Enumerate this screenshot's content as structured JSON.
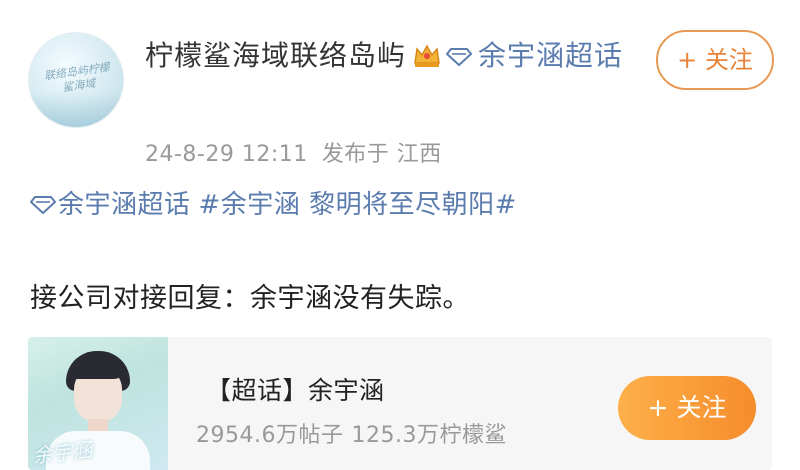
{
  "post": {
    "avatar_text": "联络岛屿柠檬鲨海域",
    "author": {
      "name": "柠檬鲨海域联络岛屿",
      "badge_icon": "crown-icon",
      "topic_link": "余宇涵超话"
    },
    "timestamp": "24-8-29 12:11",
    "location_label": "发布于 江西",
    "follow_label": "+ 关注",
    "topics": {
      "supertopic": "余宇涵超话",
      "hashtag": "#余宇涵 黎明将至尽朝阳#"
    },
    "content": "接公司对接回复：余宇涵没有失踪。"
  },
  "card": {
    "thumb_text": "余宇涵",
    "title": "【超话】余宇涵",
    "posts": "2954.6万帖子",
    "fans": "125.3万柠檬鲨",
    "follow_label": "+ 关注"
  },
  "colors": {
    "link": "#5b7cae",
    "follow_outline": "#e89a54",
    "follow_fill_start": "#fdb04a",
    "follow_fill_end": "#f68c2c",
    "meta_text": "#999999"
  }
}
